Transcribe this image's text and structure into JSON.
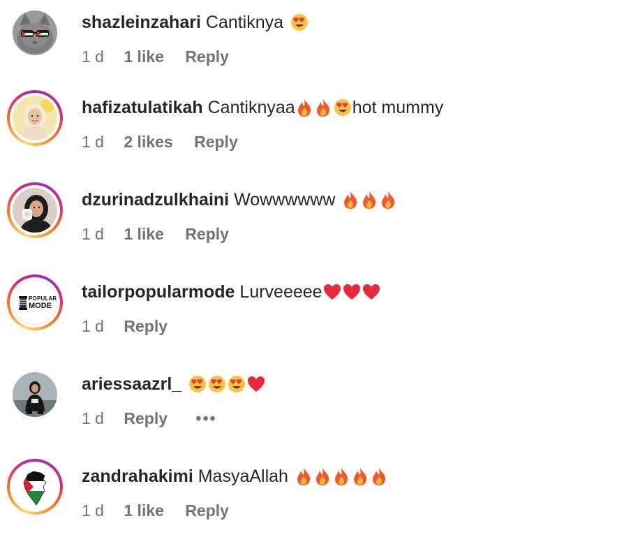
{
  "comments": [
    {
      "username": "shazleinzahari",
      "text": "Cantiknya",
      "emojis": "😍",
      "time": "1 d",
      "likes": "1 like",
      "reply": "Reply",
      "avatar_icon": "cat-with-palestine-glasses-avatar",
      "story_ring": false
    },
    {
      "username": "hafizatulatikah",
      "text": "Cantiknyaa",
      "emojis": "🔥🔥😍",
      "text_after": "hot mummy",
      "time": "1 d",
      "likes": "2 likes",
      "reply": "Reply",
      "avatar_icon": "woman-hijab-avatar",
      "story_ring": true
    },
    {
      "username": "dzurinadzulkhaini",
      "text": "Wowwwwww",
      "emojis": "🔥🔥🔥",
      "time": "1 d",
      "likes": "1 like",
      "reply": "Reply",
      "avatar_icon": "woman-selfie-avatar",
      "story_ring": true
    },
    {
      "username": "tailorpopularmode",
      "text": "Lurveeeee",
      "emojis": "❤️❤️❤️",
      "time": "1 d",
      "reply": "Reply",
      "avatar_logo_line1": "POPULAR",
      "avatar_logo_line2": "MODE",
      "avatar_icon": "popular-mode-logo-avatar",
      "story_ring": true
    },
    {
      "username": "ariessaazrl_",
      "text": "",
      "emojis": "😍😍😍❤️",
      "time": "1 d",
      "reply": "Reply",
      "more": "•••",
      "avatar_icon": "person-dark-outfit-avatar",
      "story_ring": false
    },
    {
      "username": "zandrahakimi",
      "text": "MasyaAllah",
      "emojis": "🔥🔥🔥🔥🔥",
      "time": "1 d",
      "likes": "1 like",
      "reply": "Reply",
      "avatar_icon": "palestine-map-flag-avatar",
      "story_ring": true
    }
  ],
  "colors": {
    "username": "#262626",
    "meta": "#737373",
    "ring_start": "#feda75",
    "ring_mid": "#d62976",
    "ring_end": "#962fbf"
  }
}
